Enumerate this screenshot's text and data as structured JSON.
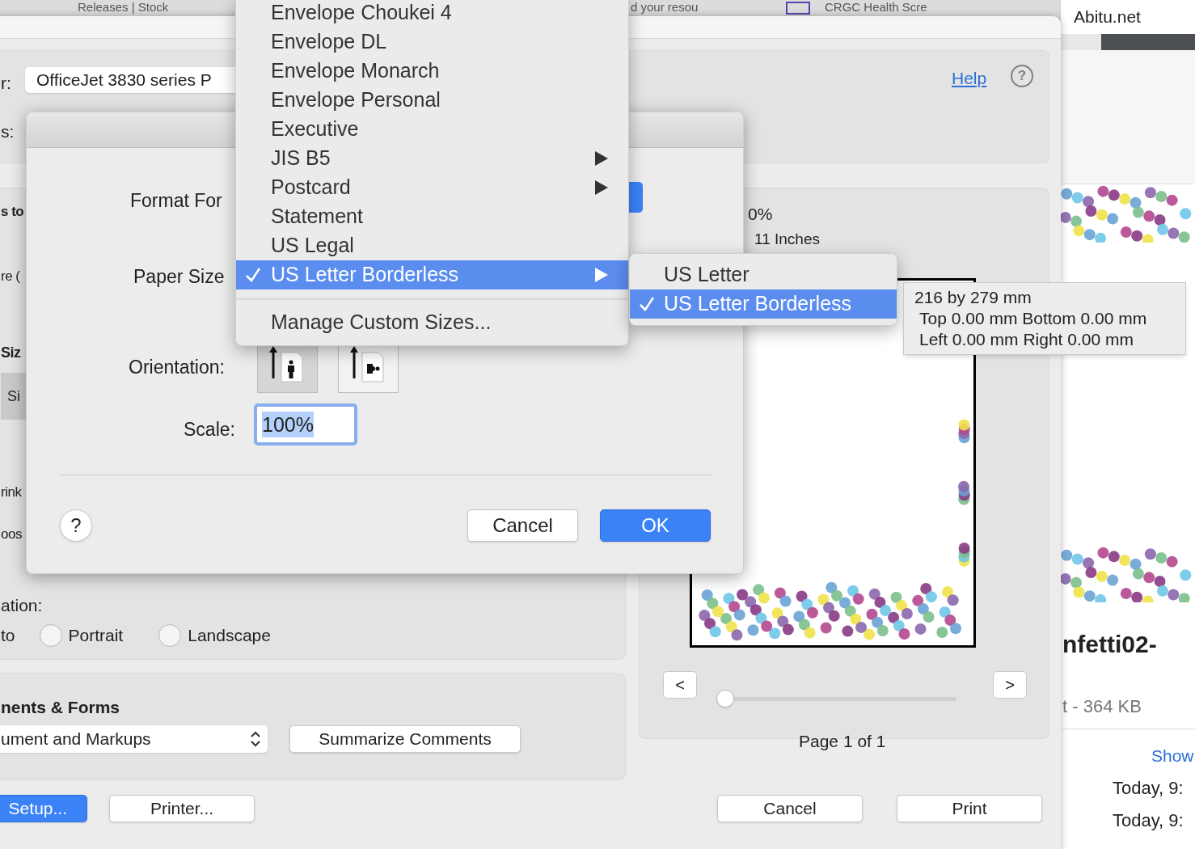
{
  "browser_tabs": [
    {
      "title": "Releases | Stock"
    },
    {
      "title": "d your resou"
    },
    {
      "title": "CRGC Health Scre"
    },
    {
      "title": "Abitu.net"
    }
  ],
  "print_dialog": {
    "printer": {
      "label": "r:",
      "value": "OfficeJet 3830 series P"
    },
    "presets": {
      "label": "s:"
    },
    "help_link": "Help",
    "help_icon": "?",
    "left_fragments": [
      {
        "text": "s to",
        "bold": true
      },
      {
        "text": "re (",
        "bold": false
      }
    ],
    "size_heading": "Siz",
    "size_tab": "Si",
    "option_fragments": [
      "rink",
      "oos"
    ],
    "orientation": {
      "label": "ation:",
      "auto": "to",
      "options": [
        {
          "label": "Portrait",
          "checked": false
        },
        {
          "label": "Landscape",
          "checked": false
        }
      ]
    },
    "comments": {
      "heading": "nents & Forms",
      "select_value": "ument and Markups",
      "button": "Summarize Comments"
    },
    "preview": {
      "scale_fragment": "0%",
      "size_fragment": "11 Inches",
      "prev": "<",
      "next": ">",
      "slider": {
        "level": 0
      },
      "page_label": "Page 1 of 1"
    },
    "buttons": [
      {
        "label": "Setup...",
        "primary": true
      },
      {
        "label": "Printer...",
        "primary": false
      },
      {
        "label": "Cancel",
        "primary": false
      },
      {
        "label": "Print",
        "primary": false
      }
    ]
  },
  "page_setup": {
    "format_for_label": "Format For",
    "paper_size_label": "Paper Size",
    "orientation_label": "Orientation:",
    "orientations": [
      {
        "kind": "portrait",
        "selected": true
      },
      {
        "kind": "landscape",
        "selected": false
      }
    ],
    "scale_label": "Scale:",
    "scale_value": "100%",
    "help": "?",
    "cancel": "Cancel",
    "ok": "OK"
  },
  "paper_menu": {
    "items": [
      {
        "label": "Envelope Choukei 4",
        "submenu": false,
        "selected": false
      },
      {
        "label": "Envelope DL",
        "submenu": false,
        "selected": false
      },
      {
        "label": "Envelope Monarch",
        "submenu": false,
        "selected": false
      },
      {
        "label": "Envelope Personal",
        "submenu": false,
        "selected": false
      },
      {
        "label": "Executive",
        "submenu": false,
        "selected": false
      },
      {
        "label": "JIS B5",
        "submenu": true,
        "selected": false
      },
      {
        "label": "Postcard",
        "submenu": true,
        "selected": false
      },
      {
        "label": "Statement",
        "submenu": false,
        "selected": false
      },
      {
        "label": "US Legal",
        "submenu": false,
        "selected": false
      },
      {
        "label": "US Letter Borderless",
        "submenu": true,
        "selected": true
      }
    ],
    "footer_item": "Manage Custom Sizes..."
  },
  "submenu": {
    "items": [
      {
        "label": "US Letter",
        "selected": false
      },
      {
        "label": "US Letter Borderless",
        "selected": true
      }
    ]
  },
  "tooltip": {
    "lines": [
      "216 by 279 mm",
      "Top 0.00 mm Bottom 0.00 mm",
      "Left 0.00 mm Right 0.00 mm"
    ]
  },
  "side_window": {
    "file_name": "nfetti02-",
    "file_info": "t - 364 KB",
    "show_link": "Show",
    "dates": [
      "Today, 9:",
      "Today, 9:"
    ]
  }
}
